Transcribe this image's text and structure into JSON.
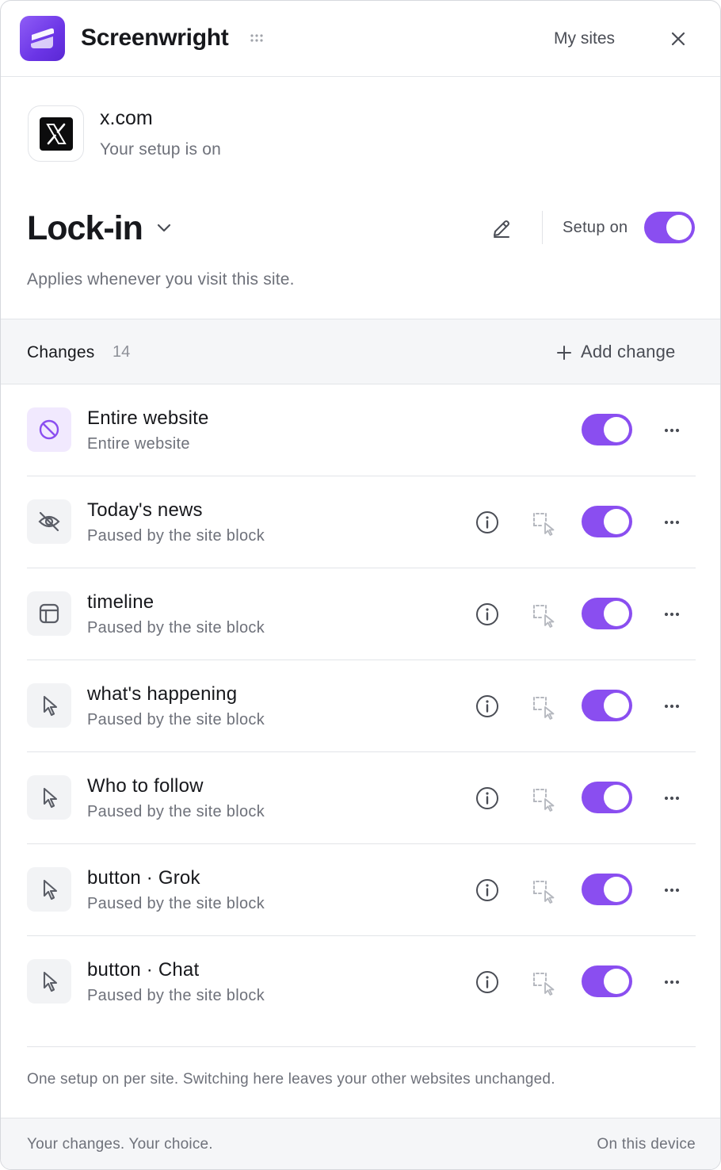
{
  "header": {
    "app_title": "Screenwright",
    "my_sites_label": "My sites",
    "logo_icon": "screenwright-logo-icon",
    "grip_icon": "drag-grip-icon",
    "close_icon": "close-icon"
  },
  "site": {
    "name": "x.com",
    "status": "Your setup is on",
    "icon": "x-logo-icon"
  },
  "setup": {
    "name": "Lock-in",
    "toggle_label": "Setup on",
    "toggle_on": true,
    "description": "Applies whenever you visit this site."
  },
  "changes": {
    "label": "Changes",
    "count": "14",
    "add_label": "Add change",
    "items": [
      {
        "title": "Entire website",
        "subtitle": "Entire website",
        "icon": "block-icon",
        "enabled": true,
        "show_actions": false
      },
      {
        "title": "Today's news",
        "subtitle": "Paused by the site block",
        "icon": "eye-off-icon",
        "enabled": true,
        "show_actions": true
      },
      {
        "title": "timeline",
        "subtitle": "Paused by the site block",
        "icon": "layout-icon",
        "enabled": true,
        "show_actions": true
      },
      {
        "title": "what's happening",
        "subtitle": "Paused by the site block",
        "icon": "pointer-icon",
        "enabled": true,
        "show_actions": true
      },
      {
        "title": "Who to follow",
        "subtitle": "Paused by the site block",
        "icon": "pointer-icon",
        "enabled": true,
        "show_actions": true
      },
      {
        "title": "button · Grok",
        "subtitle": "Paused by the site block",
        "icon": "pointer-icon",
        "enabled": true,
        "show_actions": true
      },
      {
        "title": "button · Chat",
        "subtitle": "Paused by the site block",
        "icon": "pointer-icon",
        "enabled": true,
        "show_actions": true
      }
    ]
  },
  "note": "One setup on per site. Switching here leaves your other websites unchanged.",
  "footer": {
    "left": "Your changes. Your choice.",
    "right": "On this device"
  },
  "colors": {
    "accent": "#8a4ef0",
    "text": "#17181c",
    "muted": "#6e717a",
    "bar_bg": "#f5f6f8"
  }
}
